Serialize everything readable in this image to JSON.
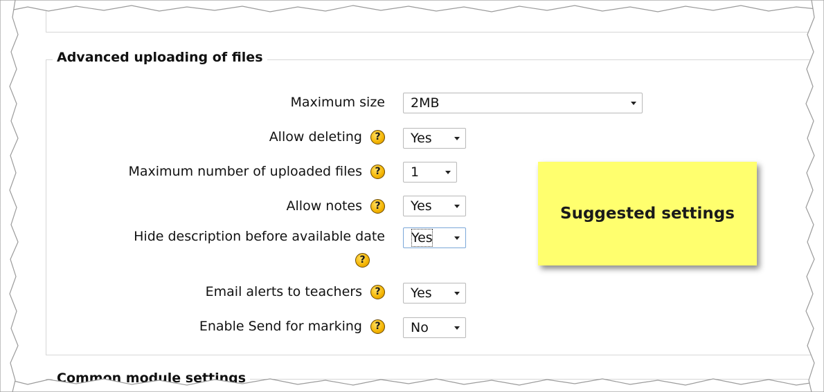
{
  "section_title": "Advanced uploading of files",
  "next_section_title": "Common module settings",
  "help_glyph": "?",
  "fields": {
    "max_size": {
      "label": "Maximum size",
      "value": "2MB"
    },
    "allow_deleting": {
      "label": "Allow deleting",
      "value": "Yes"
    },
    "max_files": {
      "label": "Maximum number of uploaded files",
      "value": "1"
    },
    "allow_notes": {
      "label": "Allow notes",
      "value": "Yes"
    },
    "hide_description": {
      "label": "Hide description before available date",
      "value": "Yes"
    },
    "email_alerts": {
      "label": "Email alerts to teachers",
      "value": "Yes"
    },
    "send_for_marking": {
      "label": "Enable Send for marking",
      "value": "No"
    }
  },
  "note": {
    "text": "Suggested settings",
    "color": "#ffff6e"
  },
  "colors": {
    "help_icon": "#f4b400",
    "fieldset_border": "#d6d6d6"
  }
}
